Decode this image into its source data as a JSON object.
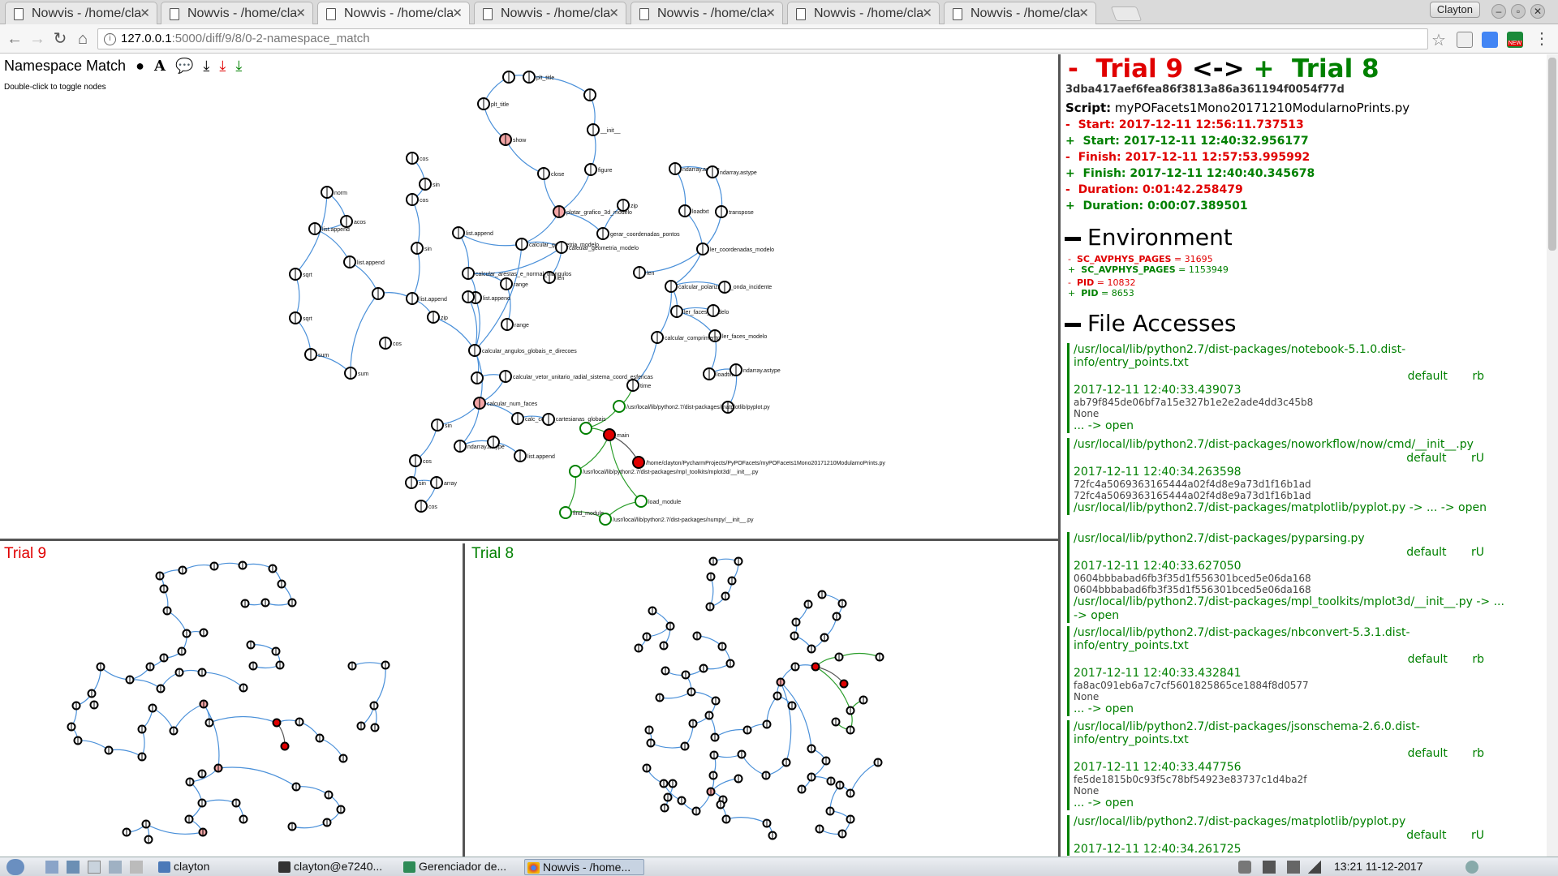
{
  "browser": {
    "tabs": [
      {
        "title": "Nowvis - /home/cla"
      },
      {
        "title": "Nowvis - /home/cla"
      },
      {
        "title": "Nowvis - /home/cla"
      },
      {
        "title": "Nowvis - /home/cla"
      },
      {
        "title": "Nowvis - /home/cla"
      },
      {
        "title": "Nowvis - /home/cla"
      },
      {
        "title": "Nowvis - /home/cla"
      }
    ],
    "active_tab": 2,
    "profile_name": "Clayton",
    "url_host": "127.0.0.1",
    "url_path": ":5000/diff/9/8/0-2-namespace_match",
    "extension_badge": "NEW"
  },
  "graph": {
    "title": "Namespace Match",
    "hint": "Double-click to toggle nodes",
    "toolbar_icons": [
      "circle-icon",
      "text-icon",
      "speech-bubble-icon",
      "download-icon",
      "download-red-icon",
      "download-green-icon"
    ],
    "labels": {
      "plt_title": "plt_title",
      "show": "show",
      "close": "close",
      "figure": "figure",
      "init": "__init__",
      "zip": "zip",
      "cos": "cos",
      "sin": "sin",
      "norm": "norm",
      "acos": "acos",
      "list_append": "list.append",
      "sqrt": "sqrt",
      "sum": "sum",
      "range": "range",
      "plotar": "plotar_grafico_3d_modelo",
      "calc_geom": "calcular_geometria_modelo",
      "gerar": "gerar_coordenadas_pontos",
      "arestas": "calcular_arestas_e_normal_triangulos",
      "angulos": "calcular_angulos_globais_e_direcoes",
      "vetor": "calcular_vetor_unitario_radial_sistema_coord_esfericas",
      "num_faces": "calcular_num_faces",
      "cartesianas": "calc_coord_cartesianas_globais",
      "ndarray_astype": "ndarray.astype",
      "loadtxt": "loadtxt",
      "transpose": "transpose",
      "ler_modelo": "ler_coordenadas_modelo",
      "polarizacao": "calcular_polarizacao_onda_incidente",
      "faces_modelo": "ler_faces_modelo",
      "comprimento": "calcular_comprimento",
      "time": "time",
      "main": "main",
      "script_path": "/home/clayton/PycharmProjects/PyPOFacets/myPOFacets1Mono20171210ModularnoPrints.py",
      "pyplot_path": "/usr/local/lib/python2.7/dist-packages/matplotlib/pyplot.py",
      "mplot3d_path": "/usr/local/lib/python2.7/dist-packages/mpl_toolkits/mplot3d/__init__.py",
      "numpy_path": "/usr/local/lib/python2.7/dist-packages/numpy/__init__.py",
      "load_module": "load_module",
      "find_module": "find_module",
      "len": "len",
      "array": "array"
    }
  },
  "panes": {
    "trial9_title": "Trial 9",
    "trial8_title": "Trial 8"
  },
  "info": {
    "minus": "-",
    "plus": "+",
    "trial_a": "Trial 9",
    "arrow": "<->",
    "trial_b": "Trial 8",
    "hash": "3dba417aef6fea86f3813a86a361194f0054f77d",
    "script_label": "Script:",
    "script_name": "myPOFacets1Mono20171210ModularnoPrints.py",
    "meta": [
      {
        "sign": "-",
        "text": "Start: 2017-12-11 12:56:11.737513",
        "color": "#e00000"
      },
      {
        "sign": "+",
        "text": "Start: 2017-12-11 12:40:32.956177",
        "color": "#008000"
      },
      {
        "sign": "-",
        "text": "Finish: 2017-12-11 12:57:53.995992",
        "color": "#e00000"
      },
      {
        "sign": "+",
        "text": "Finish: 2017-12-11 12:40:40.345678",
        "color": "#008000"
      },
      {
        "sign": "-",
        "text": "Duration: 0:01:42.258479",
        "color": "#e00000"
      },
      {
        "sign": "+",
        "text": "Duration: 0:00:07.389501",
        "color": "#008000"
      }
    ],
    "environment_title": "Environment",
    "environment": [
      {
        "sign": "-",
        "key": "SC_AVPHYS_PAGES",
        "value": "31695",
        "color": "#e00000"
      },
      {
        "sign": "+",
        "key": "SC_AVPHYS_PAGES",
        "value": "1153949",
        "color": "#008000"
      },
      {
        "sign": "-",
        "key": "PID",
        "value": "10832",
        "color": "#e00000"
      },
      {
        "sign": "+",
        "key": "PID",
        "value": "8653",
        "color": "#008000"
      }
    ],
    "file_accesses_title": "File Accesses",
    "file_accesses": [
      {
        "path": "/usr/local/lib/python2.7/dist-packages/notebook-5.1.0.dist-info/entry_points.txt",
        "mode": "default rb",
        "time": "2017-12-11 12:40:33.439073",
        "hashes": [
          "ab79f845de06bf7a15e327b1e2e2ade4dd3c45b8",
          "None"
        ],
        "open": "... -> open"
      },
      {
        "path": "/usr/local/lib/python2.7/dist-packages/noworkflow/now/cmd/__init__.py",
        "mode": "default rU",
        "time": "2017-12-11 12:40:34.263598",
        "hashes": [
          "72fc4a5069363165444a02f4d8e9a73d1f16b1ad",
          "72fc4a5069363165444a02f4d8e9a73d1f16b1ad"
        ],
        "open": "/usr/local/lib/python2.7/dist-packages/matplotlib/pyplot.py -> ... -> open"
      },
      {
        "path": "/usr/local/lib/python2.7/dist-packages/pyparsing.py",
        "mode": "default rU",
        "time": "2017-12-11 12:40:33.627050",
        "hashes": [
          "0604bbbabad6fb3f35d1f556301bced5e06da168",
          "0604bbbabad6fb3f35d1f556301bced5e06da168"
        ],
        "open": "/usr/local/lib/python2.7/dist-packages/mpl_toolkits/mplot3d/__init__.py -> ... -> open"
      },
      {
        "path": "/usr/local/lib/python2.7/dist-packages/nbconvert-5.3.1.dist-info/entry_points.txt",
        "mode": "default rb",
        "time": "2017-12-11 12:40:33.432841",
        "hashes": [
          "fa8ac091eb6a7c7cf5601825865ce1884f8d0577",
          "None"
        ],
        "open": "... -> open"
      },
      {
        "path": "/usr/local/lib/python2.7/dist-packages/jsonschema-2.6.0.dist-info/entry_points.txt",
        "mode": "default rb",
        "time": "2017-12-11 12:40:33.447756",
        "hashes": [
          "fe5de1815b0c93f5c78bf54923e83737c1d4ba2f",
          "None"
        ],
        "open": "... -> open"
      },
      {
        "path": "/usr/local/lib/python2.7/dist-packages/matplotlib/pyplot.py",
        "mode": "default rU",
        "time": "2017-12-11 12:40:34.261725",
        "hashes": [],
        "open": ""
      }
    ]
  },
  "taskbar": {
    "items": [
      {
        "label": "clayton"
      },
      {
        "label": "clayton@e7240..."
      },
      {
        "label": "Gerenciador de..."
      },
      {
        "label": "Nowvis - /home..."
      }
    ],
    "clock": "13:21 11-12-2017"
  }
}
